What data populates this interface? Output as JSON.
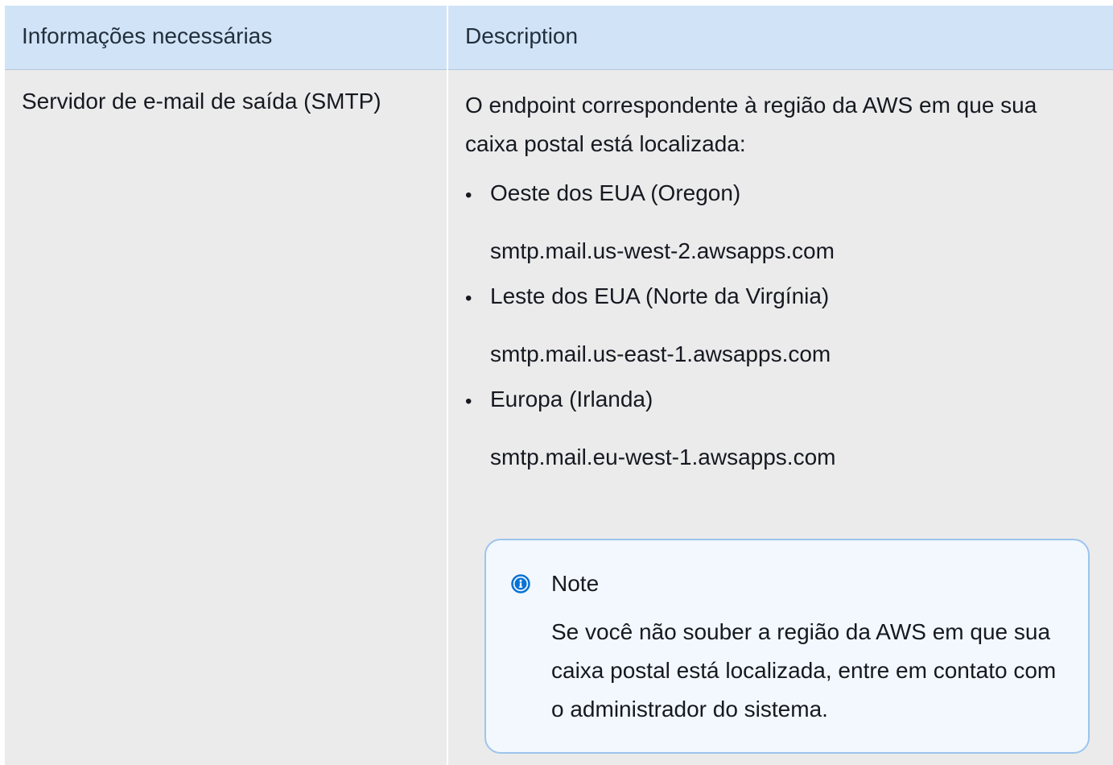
{
  "table": {
    "headers": [
      "Informações necessárias",
      "Description"
    ],
    "row": {
      "field": "Servidor de e-mail de saída (SMTP)",
      "intro": "O endpoint correspondente à região da AWS em que sua caixa postal está localizada:",
      "regions": [
        {
          "name": "Oeste dos EUA (Oregon)",
          "endpoint": "smtp.mail.us-west-2.awsapps.com"
        },
        {
          "name": "Leste dos EUA (Norte da Virgínia)",
          "endpoint": "smtp.mail.us-east-1.awsapps.com"
        },
        {
          "name": "Europa (Irlanda)",
          "endpoint": "smtp.mail.eu-west-1.awsapps.com"
        }
      ]
    }
  },
  "note": {
    "icon": "info-icon",
    "title": "Note",
    "body": "Se você não souber a região da AWS em que sua caixa postal está localizada, entre em contato com o administrador do sistema."
  },
  "colors": {
    "header_bg": "#d1e4f7",
    "cell_bg": "#ebebec",
    "note_bg": "#f2f8fd",
    "note_border": "#9dc4ec",
    "info_icon": "#0972d3"
  }
}
